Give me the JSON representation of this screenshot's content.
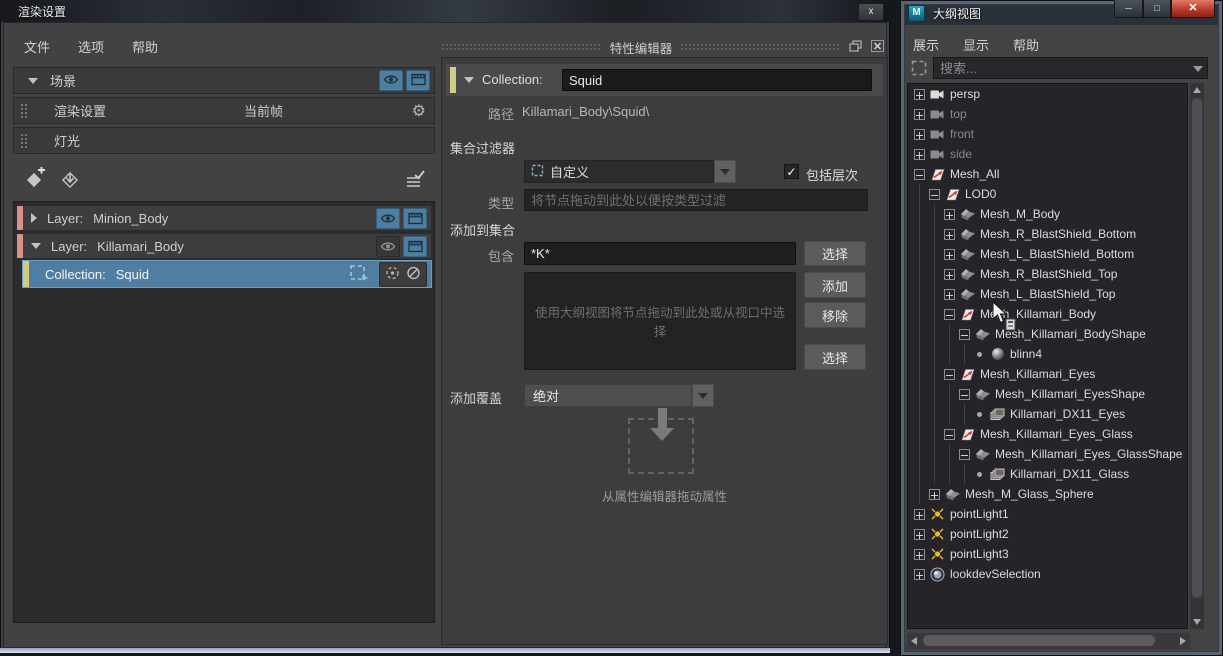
{
  "colors": {
    "accent_blue": "#4e7fa1",
    "selection_blue": "#4f7ea2",
    "layer_bar_salmon": "#d9918c",
    "collection_bar_yellow": "#d3cb83",
    "light_yellow": "#e3bd2f",
    "close_red": "#b5372a",
    "outliner_bg": "#262329",
    "panel_bg": "#424242"
  },
  "render_setup": {
    "title": "渲染设置",
    "menu": [
      "文件",
      "选项",
      "帮助"
    ],
    "scene_row": {
      "label": "场景"
    },
    "render_settings_row": {
      "label": "渲染设置",
      "value": "当前帧"
    },
    "lights_row": {
      "label": "灯光"
    },
    "layers": [
      {
        "kind": "layer",
        "prefix": "Layer:",
        "name": "Minion_Body",
        "expanded": false,
        "eye_on": true,
        "renderable": true
      },
      {
        "kind": "layer",
        "prefix": "Layer:",
        "name": "Killamari_Body",
        "expanded": true,
        "eye_on": false,
        "renderable": true
      },
      {
        "kind": "collection",
        "prefix": "Collection:",
        "name": "Squid",
        "selected": true
      }
    ]
  },
  "property_editor": {
    "title": "特性编辑器",
    "header_label": "Collection:",
    "header_value": "Squid",
    "path_label": "路径",
    "path_value": "Killamari_Body\\Squid\\",
    "filters_section": "集合过滤器",
    "filter_dropdown_value": "自定义",
    "include_hierarchy_label": "包括层次",
    "include_hierarchy_checked": true,
    "type_label": "类型",
    "type_placeholder": "将节点拖动到此处以便按类型过滤",
    "add_section": "添加到集合",
    "include_label": "包含",
    "include_value": "*K*",
    "select_top_button": "选择",
    "add_button": "添加",
    "remove_button": "移除",
    "select_bottom_button": "选择",
    "drop_placeholder": "使用大纲视图将节点拖动到此处或从视口中选择",
    "override_label": "添加覆盖",
    "override_value": "绝对",
    "drag_hint": "从属性编辑器拖动属性"
  },
  "outliner": {
    "title": "大纲视图",
    "menu": [
      "展示",
      "显示",
      "帮助"
    ],
    "search_placeholder": "搜索...",
    "tree": [
      {
        "label": "persp",
        "level": 0,
        "toggle": "plus",
        "icon": "camera-icon"
      },
      {
        "label": "top",
        "level": 0,
        "toggle": "plus",
        "icon": "camera-icon",
        "dim": true
      },
      {
        "label": "front",
        "level": 0,
        "toggle": "plus",
        "icon": "camera-icon",
        "dim": true
      },
      {
        "label": "side",
        "level": 0,
        "toggle": "plus",
        "icon": "camera-icon",
        "dim": true
      },
      {
        "label": "Mesh_All",
        "level": 0,
        "toggle": "minus",
        "icon": "transform-icon"
      },
      {
        "label": "LOD0",
        "level": 1,
        "toggle": "minus",
        "icon": "transform-icon"
      },
      {
        "label": "Mesh_M_Body",
        "level": 2,
        "toggle": "plus",
        "icon": "mesh-icon"
      },
      {
        "label": "Mesh_R_BlastShield_Bottom",
        "level": 2,
        "toggle": "plus",
        "icon": "mesh-icon"
      },
      {
        "label": "Mesh_L_BlastShield_Bottom",
        "level": 2,
        "toggle": "plus",
        "icon": "mesh-icon"
      },
      {
        "label": "Mesh_R_BlastShield_Top",
        "level": 2,
        "toggle": "plus",
        "icon": "mesh-icon"
      },
      {
        "label": "Mesh_L_BlastShield_Top",
        "level": 2,
        "toggle": "plus",
        "icon": "mesh-icon"
      },
      {
        "label": "Mesh_Killamari_Body",
        "level": 2,
        "toggle": "minus",
        "icon": "transform-icon"
      },
      {
        "label": "Mesh_Killamari_BodyShape",
        "level": 3,
        "toggle": "minus",
        "icon": "mesh-icon"
      },
      {
        "label": "blinn4",
        "level": 4,
        "toggle": "dot",
        "icon": "material-icon"
      },
      {
        "label": "Mesh_Killamari_Eyes",
        "level": 2,
        "toggle": "minus",
        "icon": "transform-icon"
      },
      {
        "label": "Mesh_Killamari_EyesShape",
        "level": 3,
        "toggle": "minus",
        "icon": "mesh-icon"
      },
      {
        "label": "Killamari_DX11_Eyes",
        "level": 4,
        "toggle": "dot",
        "icon": "shader-icon"
      },
      {
        "label": "Mesh_Killamari_Eyes_Glass",
        "level": 2,
        "toggle": "minus",
        "icon": "transform-icon"
      },
      {
        "label": "Mesh_Killamari_Eyes_GlassShape",
        "level": 3,
        "toggle": "minus",
        "icon": "mesh-icon"
      },
      {
        "label": "Killamari_DX11_Glass",
        "level": 4,
        "toggle": "dot",
        "icon": "shader-icon"
      },
      {
        "label": "Mesh_M_Glass_Sphere",
        "level": 1,
        "toggle": "plus",
        "icon": "mesh-icon"
      },
      {
        "label": "pointLight1",
        "level": 0,
        "toggle": "plus",
        "icon": "light-icon"
      },
      {
        "label": "pointLight2",
        "level": 0,
        "toggle": "plus",
        "icon": "light-icon"
      },
      {
        "label": "pointLight3",
        "level": 0,
        "toggle": "plus",
        "icon": "light-icon"
      },
      {
        "label": "lookdevSelection",
        "level": 0,
        "toggle": "plus",
        "icon": "lookdev-icon"
      }
    ]
  },
  "icons": [
    "eye-icon",
    "clapperboard-icon",
    "gear-icon",
    "create-layer-icon",
    "import-layer-icon",
    "checklist-icon",
    "isolate-select-icon",
    "dashed-circle-icon",
    "no-sign-icon",
    "filter-custom-icon",
    "select-filter-icon",
    "float-pane-icon",
    "close-icon",
    "minimize-icon",
    "maximize-icon",
    "maya-logo-icon",
    "drop-arrow-icon",
    "cursor-arrow-icon"
  ]
}
